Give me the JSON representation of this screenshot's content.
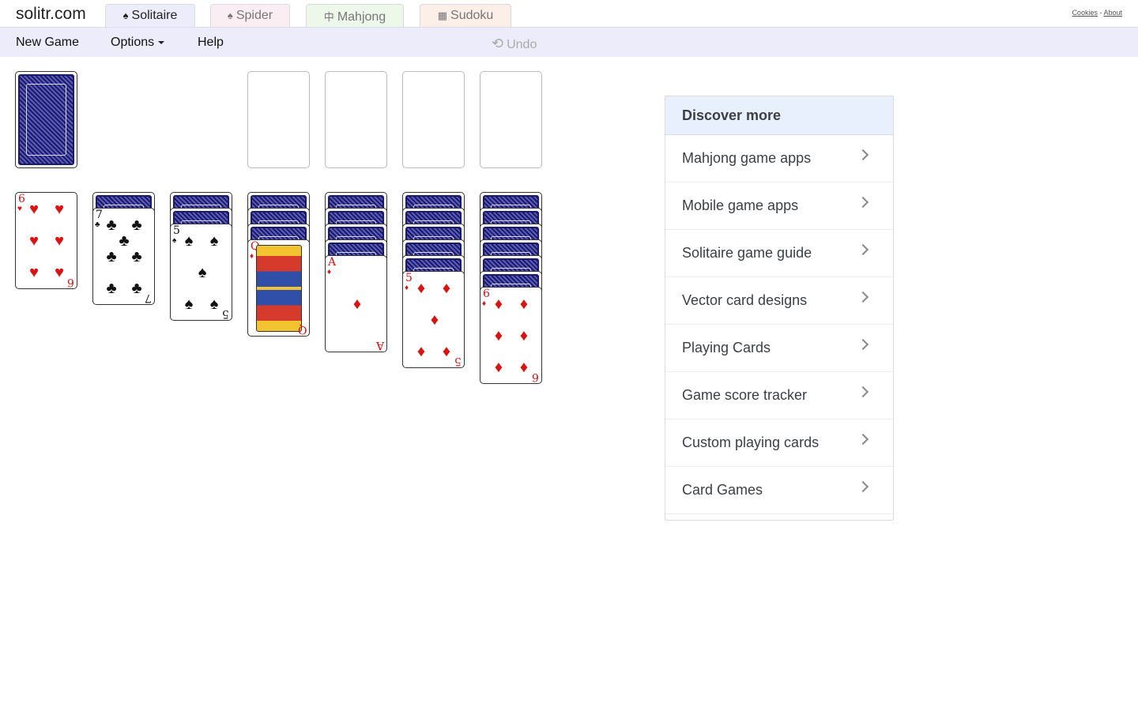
{
  "header": {
    "logo": "solitr.com",
    "tabs": [
      {
        "glyph": "♠",
        "label": "Solitaire"
      },
      {
        "glyph": "♠",
        "label": "Spider"
      },
      {
        "glyph": "中",
        "label": "Mahjong"
      },
      {
        "glyph": "▦",
        "label": "Sudoku"
      }
    ],
    "links": {
      "cookies": "Cookies",
      "sep": " - ",
      "about": "About"
    }
  },
  "menu": {
    "new_game": "New Game",
    "options": "Options",
    "help": "Help",
    "undo": "Undo"
  },
  "game": {
    "tableau": [
      {
        "face_down": 0,
        "face_up": {
          "rank": "6",
          "suit": "♥",
          "color": "red"
        }
      },
      {
        "face_down": 1,
        "face_up": {
          "rank": "7",
          "suit": "♣",
          "color": "black"
        }
      },
      {
        "face_down": 2,
        "face_up": {
          "rank": "5",
          "suit": "♠",
          "color": "black"
        }
      },
      {
        "face_down": 3,
        "face_up": {
          "rank": "Q",
          "suit": "♦",
          "color": "red"
        }
      },
      {
        "face_down": 4,
        "face_up": {
          "rank": "A",
          "suit": "♦",
          "color": "red"
        }
      },
      {
        "face_down": 5,
        "face_up": {
          "rank": "5",
          "suit": "♦",
          "color": "red"
        }
      },
      {
        "face_down": 6,
        "face_up": {
          "rank": "6",
          "suit": "♦",
          "color": "red"
        }
      }
    ]
  },
  "sidebar": {
    "title": "Discover more",
    "items": [
      "Mahjong game apps",
      "Mobile game apps",
      "Solitaire game guide",
      "Vector card designs",
      "Playing Cards",
      "Game score tracker",
      "Custom playing cards",
      "Card Games"
    ]
  },
  "colors": {
    "menu_bg": "#ececfa",
    "card_back": "#1a1a6b",
    "red_suit": "#e01010",
    "sidebar_head": "#e8f0fe"
  }
}
